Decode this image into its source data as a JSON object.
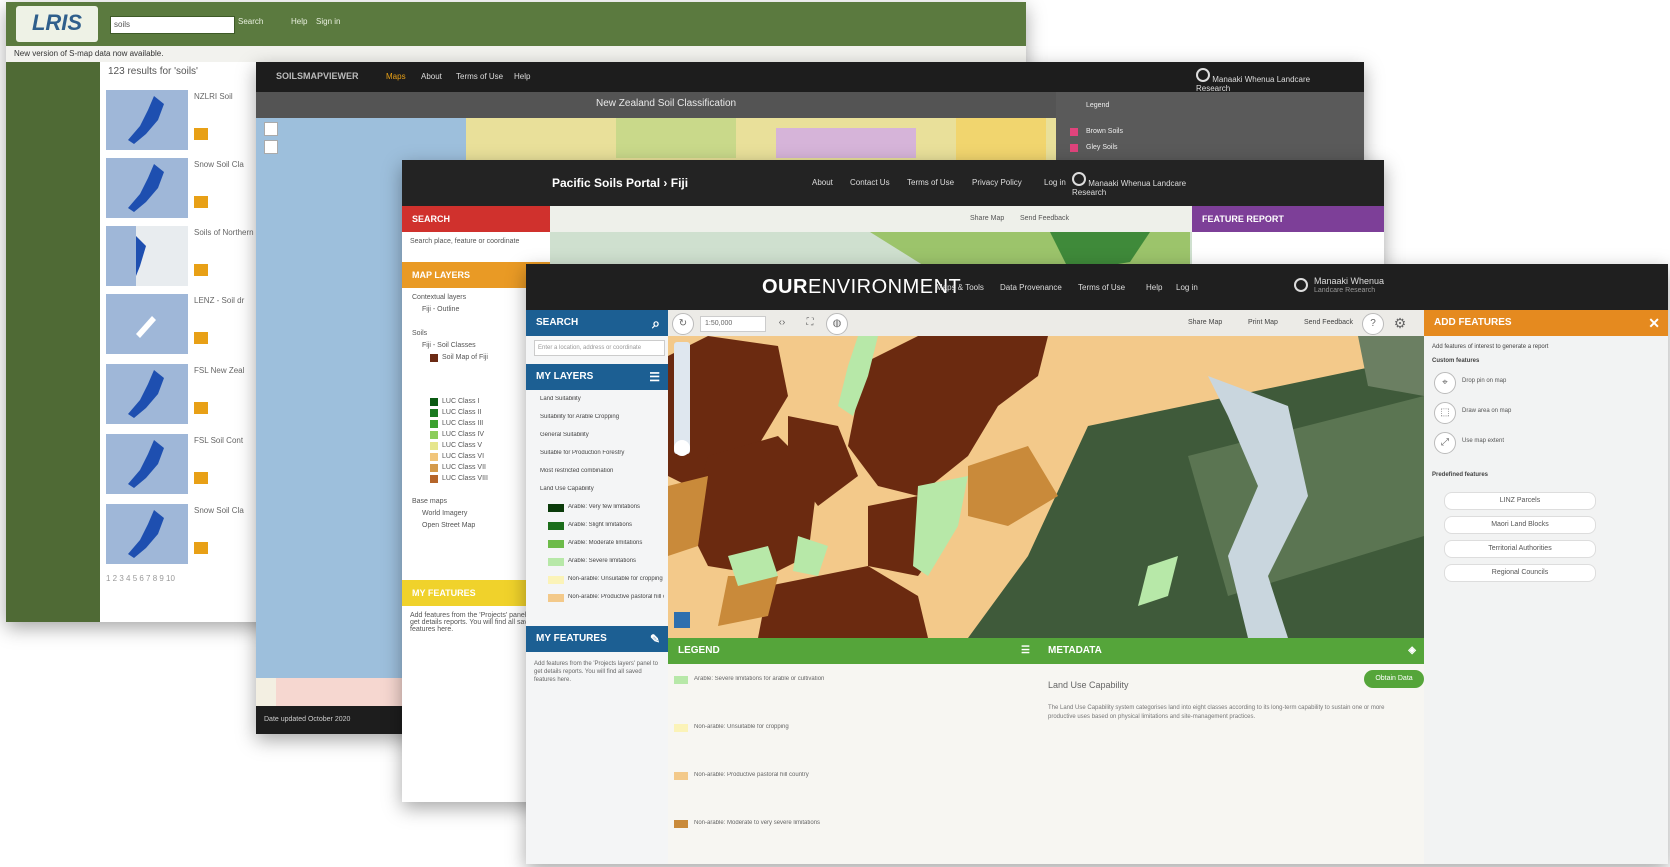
{
  "lris": {
    "logo": "LRIS",
    "search_value": "soils",
    "search_label": "Search",
    "nav": [
      "Help",
      "Sign in"
    ],
    "notice": "New version of S-map data now available.",
    "results_count": "123 results for 'soils'",
    "results": [
      "NZLRI Soil",
      "Snow Soil Cla",
      "Soils of Northern",
      "LENZ - Soil dr",
      "FSL New Zeal",
      "FSL Soil Cont",
      "Snow Soil Cla"
    ],
    "pager": "1 2 3 4 5 6 7 8 9 10"
  },
  "soils_viewer": {
    "brand": "SOILSMAPVIEWER",
    "nav": [
      "Maps",
      "About",
      "Terms of Use",
      "Help"
    ],
    "map_title": "New Zealand Soil Classification",
    "partner": "Manaaki Whenua Landcare Research",
    "footer": "Date updated October 2020",
    "legend_title": "Legend",
    "legend_items": [
      "Brown Soils",
      "Gley Soils"
    ]
  },
  "pacific": {
    "title": "Pacific Soils Portal",
    "crumb": "Fiji",
    "nav": [
      "About",
      "Contact Us",
      "Terms of Use",
      "Privacy Policy",
      "Log in"
    ],
    "partner": "Manaaki Whenua Landcare Research",
    "search": "SEARCH",
    "search_placeholder": "Search place, feature or coordinate",
    "map_layers": "MAP LAYERS",
    "my_features": "MY FEATURES",
    "feature_report": "FEATURE REPORT",
    "toolbar": [
      "Share Map",
      "Send Feedback"
    ],
    "layers": [
      "Contextual layers",
      "Fiji - Outline",
      "Soils",
      "Fiji - Soil Classes",
      "Soil Map of Fiji",
      "LUC Class I",
      "LUC Class II",
      "LUC Class III",
      "LUC Class IV",
      "LUC Class V",
      "LUC Class VI",
      "LUC Class VII",
      "LUC Class VIII",
      "Base maps",
      "World Imagery",
      "Open Street Map"
    ],
    "my_features_hint": "Add features from the 'Projects' panel to get details reports. You will find all saved features here."
  },
  "ourenv": {
    "brand_bold": "OUR",
    "brand_rest": "ENVIRONMENT",
    "nav": [
      "Maps & Tools",
      "Data Provenance",
      "Terms of Use",
      "Help",
      "Log in"
    ],
    "partner_line1": "Manaaki Whenua",
    "partner_line2": "Landcare Research",
    "search": "SEARCH",
    "search_placeholder": "Enter a location, address or coordinate",
    "my_layers": "MY LAYERS",
    "my_features": "MY FEATURES",
    "my_features_hint": "Add features from the 'Projects layers' panel to get details reports. You will find all saved features here.",
    "layers": [
      {
        "label": "Land Suitability",
        "color": ""
      },
      {
        "label": "Suitability for Arable Cropping",
        "color": ""
      },
      {
        "label": "General Suitability",
        "color": ""
      },
      {
        "label": "Suitable for Production Forestry",
        "color": ""
      },
      {
        "label": "Most restricted combination",
        "color": ""
      },
      {
        "label": "Land Use Capability",
        "color": ""
      },
      {
        "label": "Arable: Very few limitations",
        "color": "#0a3a0a"
      },
      {
        "label": "Arable: Slight limitations",
        "color": "#1b6d1b"
      },
      {
        "label": "Arable: Moderate limitations",
        "color": "#6dbb4a"
      },
      {
        "label": "Arable: Severe limitations",
        "color": "#b7e8a8"
      },
      {
        "label": "Non-arable: Unsuitable for cropping",
        "color": "#fbf3b8"
      },
      {
        "label": "Non-arable: Productive pastoral hill country",
        "color": "#f3c98a"
      }
    ],
    "scale": "1:50,000",
    "map_tools": [
      "Share Map",
      "Print Map",
      "Send Feedback"
    ],
    "add_features": "ADD FEATURES",
    "add_features_hint": "Add features of interest to generate a report",
    "custom_features": "Custom features",
    "custom_tools": [
      "Drop pin on map",
      "Draw area on map",
      "Use map extent"
    ],
    "predefined": "Predefined features",
    "predefined_buttons": [
      "LINZ Parcels",
      "Maori Land Blocks",
      "Territorial Authorities",
      "Regional Councils"
    ],
    "legend": "LEGEND",
    "metadata": "METADATA",
    "legend_items": [
      {
        "label": "Arable: Severe limitations for arable or cultivation",
        "color": "#b7e8a8"
      },
      {
        "label": "Non-arable: Unsuitable for cropping",
        "color": "#fbf3b8"
      },
      {
        "label": "Non-arable: Productive pastoral hill country",
        "color": "#f3c98a"
      },
      {
        "label": "Non-arable: Moderate to very severe limitations",
        "color": "#c98a3a"
      }
    ],
    "metadata_title": "Land Use Capability",
    "obtain": "Obtain Data",
    "metadata_text": "The Land Use Capability system categorises land into eight classes according to its long-term capability to sustain one or more productive uses based on physical limitations and site-management practices."
  }
}
